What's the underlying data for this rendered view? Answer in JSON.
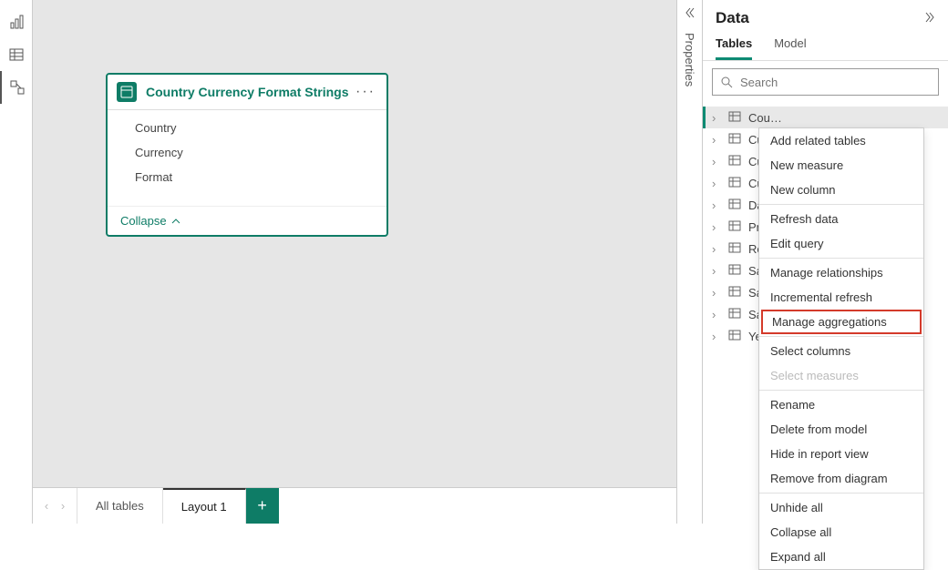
{
  "left_rail": {
    "items": [
      "report-view",
      "data-view",
      "model-view"
    ],
    "active": 2
  },
  "canvas": {
    "table_card": {
      "title": "Country Currency Format Strings",
      "fields": [
        "Country",
        "Currency",
        "Format"
      ],
      "collapse_label": "Collapse"
    }
  },
  "bottom_bar": {
    "tabs": [
      {
        "label": "All tables",
        "active": false
      },
      {
        "label": "Layout 1",
        "active": true
      }
    ]
  },
  "properties_rail": {
    "label": "Properties"
  },
  "data_pane": {
    "title": "Data",
    "tabs": [
      {
        "label": "Tables",
        "active": true
      },
      {
        "label": "Model",
        "active": false
      }
    ],
    "search_placeholder": "Search",
    "tables": [
      {
        "name": "Cou",
        "selected": true
      },
      {
        "name": "Cur"
      },
      {
        "name": "Cur"
      },
      {
        "name": "Cus"
      },
      {
        "name": "Dat"
      },
      {
        "name": "Pro"
      },
      {
        "name": "Res"
      },
      {
        "name": "Sal"
      },
      {
        "name": "Sal"
      },
      {
        "name": "Sal"
      },
      {
        "name": "Yea"
      }
    ]
  },
  "context_menu": {
    "items": [
      {
        "label": "Add related tables"
      },
      {
        "label": "New measure"
      },
      {
        "label": "New column"
      },
      {
        "sep": true
      },
      {
        "label": "Refresh data"
      },
      {
        "label": "Edit query"
      },
      {
        "sep": true
      },
      {
        "label": "Manage relationships"
      },
      {
        "label": "Incremental refresh"
      },
      {
        "label": "Manage aggregations",
        "highlight": true
      },
      {
        "sep": true
      },
      {
        "label": "Select columns"
      },
      {
        "label": "Select measures",
        "disabled": true
      },
      {
        "sep": true
      },
      {
        "label": "Rename"
      },
      {
        "label": "Delete from model"
      },
      {
        "label": "Hide in report view"
      },
      {
        "label": "Remove from diagram"
      },
      {
        "sep": true
      },
      {
        "label": "Unhide all"
      },
      {
        "label": "Collapse all"
      },
      {
        "label": "Expand all"
      }
    ]
  }
}
